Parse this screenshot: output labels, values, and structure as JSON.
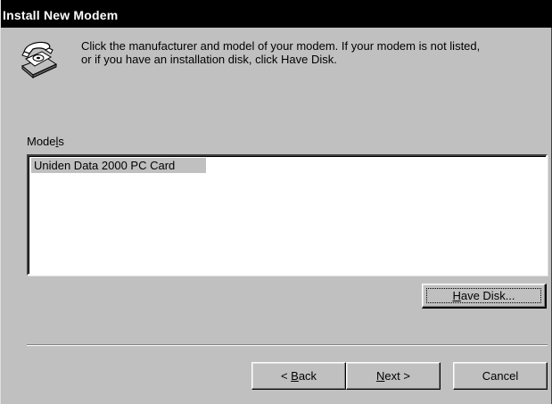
{
  "dialog": {
    "title": "Install New Modem",
    "instructions_line1": "Click the manufacturer and model of your modem. If your modem is not listed,",
    "instructions_line2": "or if you have an installation disk, click Have Disk.",
    "icon": "telephone-modem-icon"
  },
  "models": {
    "label_prefix": "Mode",
    "label_accel": "l",
    "label_suffix": "s",
    "items": [
      "Uniden Data 2000 PC Card"
    ],
    "selected_index": 0
  },
  "buttons": {
    "have_disk": {
      "accel": "H",
      "rest": "ave Disk..."
    },
    "back": {
      "prefix": "< ",
      "accel": "B",
      "rest": "ack"
    },
    "next": {
      "accel": "N",
      "rest": "ext >"
    },
    "cancel": "Cancel"
  }
}
